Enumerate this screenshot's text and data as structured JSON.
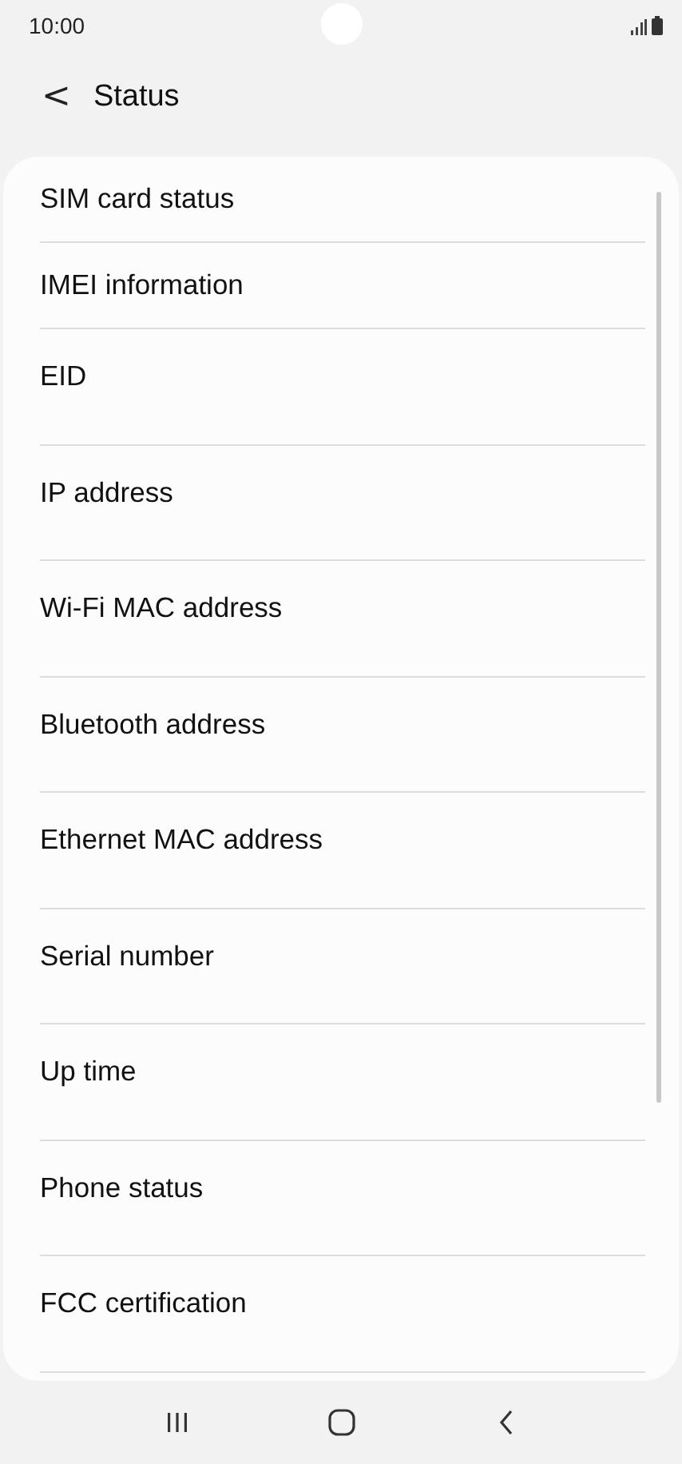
{
  "status_bar": {
    "time": "10:00"
  },
  "header": {
    "back": "<",
    "title": "Status"
  },
  "items": [
    {
      "label": "SIM card status",
      "kind": "short"
    },
    {
      "label": "IMEI information",
      "kind": "short"
    },
    {
      "label": "EID",
      "kind": "tall"
    },
    {
      "label": "IP address",
      "kind": "tall"
    },
    {
      "label": "Wi-Fi MAC address",
      "kind": "tall"
    },
    {
      "label": "Bluetooth address",
      "kind": "tall"
    },
    {
      "label": "Ethernet MAC address",
      "kind": "tall"
    },
    {
      "label": "Serial number",
      "kind": "tall"
    },
    {
      "label": "Up time",
      "kind": "tall"
    },
    {
      "label": "Phone status",
      "kind": "tall"
    },
    {
      "label": "FCC certification",
      "kind": "tall"
    }
  ]
}
